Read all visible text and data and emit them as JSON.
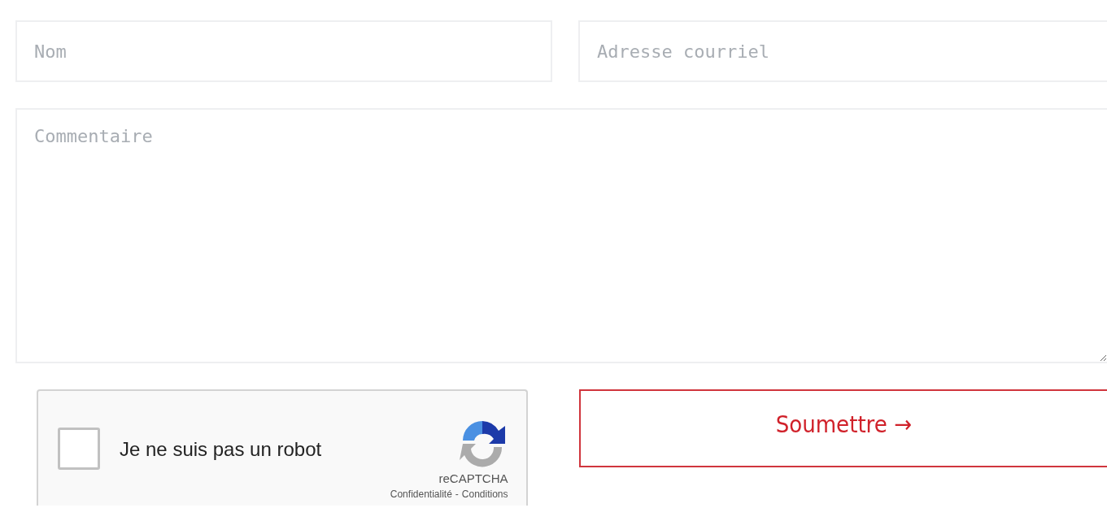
{
  "name_field": {
    "placeholder": "Nom"
  },
  "email_field": {
    "placeholder": "Adresse courriel"
  },
  "comment_field": {
    "placeholder": "Commentaire"
  },
  "captcha": {
    "label": "Je ne suis pas un robot",
    "checked": false,
    "brand": "reCAPTCHA",
    "privacy_link": "Confidentialité",
    "separator": "-",
    "terms_link": "Conditions"
  },
  "submit_button": {
    "label": "Soumettre →"
  }
}
